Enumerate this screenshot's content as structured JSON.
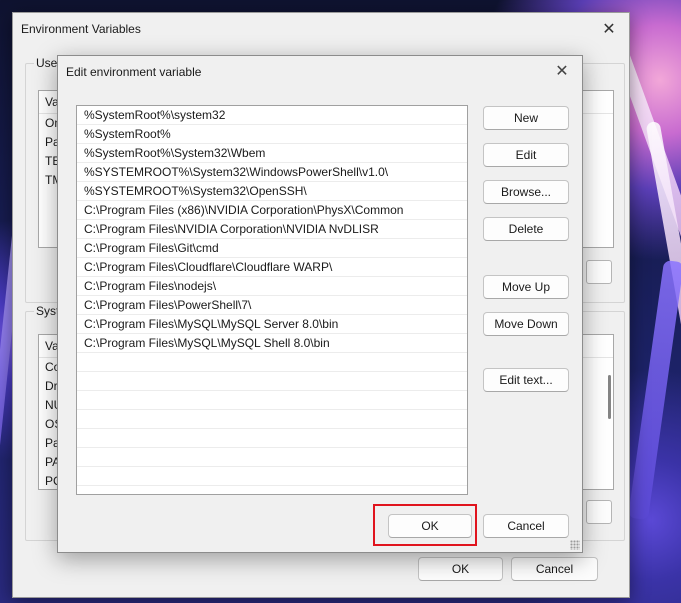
{
  "parent_window": {
    "title": "Environment Variables",
    "user_group_label": "User",
    "user_list": {
      "column_header": "Va",
      "rows": [
        "On",
        "Pa",
        "TE",
        "TM"
      ]
    },
    "system_group_label": "Syste",
    "system_list": {
      "column_header": "Va",
      "rows": [
        "Co",
        "Dr",
        "NU",
        "OS",
        "Pa",
        "PA",
        "PC"
      ]
    },
    "ok_label": "OK",
    "cancel_label": "Cancel"
  },
  "dialog": {
    "title": "Edit environment variable",
    "paths": [
      "%SystemRoot%\\system32",
      "%SystemRoot%",
      "%SystemRoot%\\System32\\Wbem",
      "%SYSTEMROOT%\\System32\\WindowsPowerShell\\v1.0\\",
      "%SYSTEMROOT%\\System32\\OpenSSH\\",
      "C:\\Program Files (x86)\\NVIDIA Corporation\\PhysX\\Common",
      "C:\\Program Files\\NVIDIA Corporation\\NVIDIA NvDLISR",
      "C:\\Program Files\\Git\\cmd",
      "C:\\Program Files\\Cloudflare\\Cloudflare WARP\\",
      "C:\\Program Files\\nodejs\\",
      "C:\\Program Files\\PowerShell\\7\\",
      "C:\\Program Files\\MySQL\\MySQL Server 8.0\\bin",
      "C:\\Program Files\\MySQL\\MySQL Shell 8.0\\bin"
    ],
    "buttons": {
      "new": "New",
      "edit": "Edit",
      "browse": "Browse...",
      "delete": "Delete",
      "move_up": "Move Up",
      "move_down": "Move Down",
      "edit_text": "Edit text...",
      "ok": "OK",
      "cancel": "Cancel"
    },
    "highlight_color": "#e0141e"
  },
  "icons": {
    "close": "close-icon"
  }
}
